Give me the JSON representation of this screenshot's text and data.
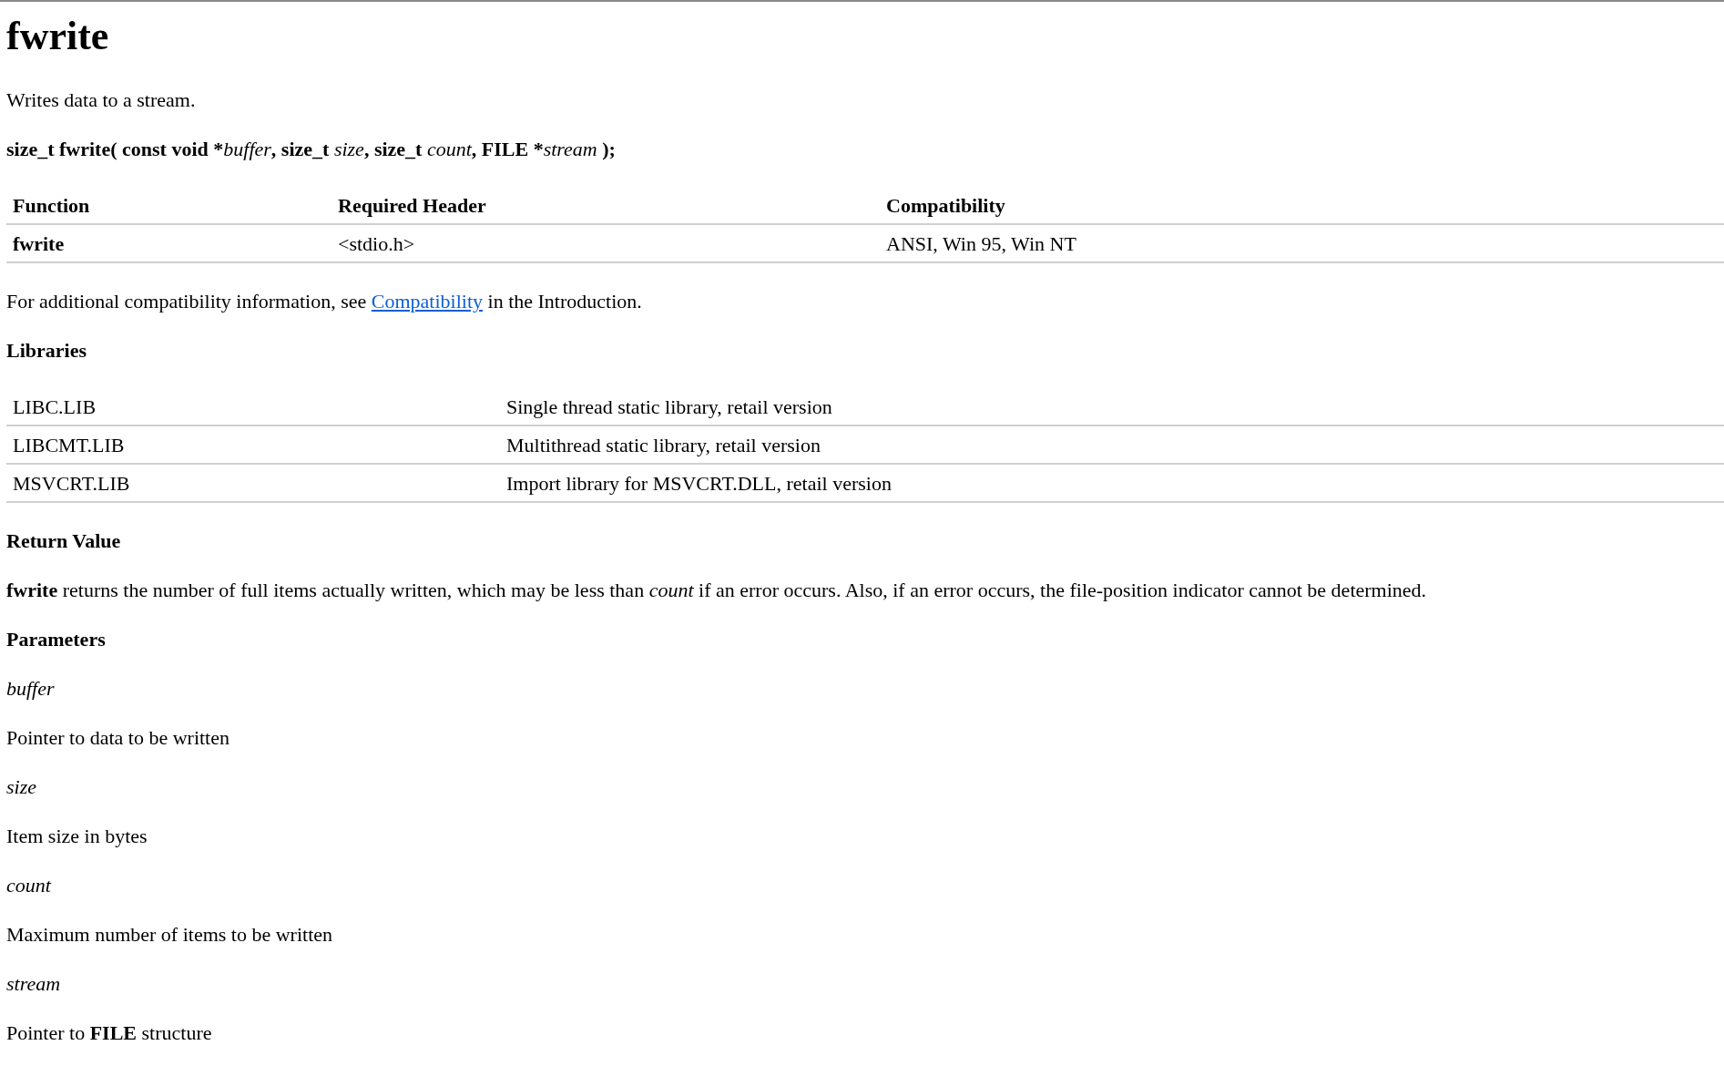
{
  "title": "fwrite",
  "summary": "Writes data to a stream.",
  "syntax": [
    {
      "kind": "bold",
      "text": "size_t fwrite( const void *"
    },
    {
      "kind": "italic",
      "text": "buffer"
    },
    {
      "kind": "bold",
      "text": ", size_t "
    },
    {
      "kind": "italic",
      "text": "size"
    },
    {
      "kind": "bold",
      "text": ", size_t "
    },
    {
      "kind": "italic",
      "text": "count"
    },
    {
      "kind": "bold",
      "text": ", FILE *"
    },
    {
      "kind": "italic",
      "text": "stream"
    },
    {
      "kind": "bold",
      "text": " );"
    }
  ],
  "requirements_table": {
    "columns": [
      "Function",
      "Required Header",
      "Compatibility"
    ],
    "rows": [
      [
        "fwrite",
        "<stdio.h>",
        "ANSI, Win 95, Win NT"
      ]
    ]
  },
  "compatibility_note": [
    {
      "kind": "plain",
      "text": "For additional compatibility information, see "
    },
    {
      "kind": "link",
      "text": "Compatibility"
    },
    {
      "kind": "plain",
      "text": " in the Introduction."
    }
  ],
  "libraries_heading": "Libraries",
  "libraries_table": {
    "rows": [
      [
        "LIBC.LIB",
        "Single thread static library, retail version"
      ],
      [
        "LIBCMT.LIB",
        "Multithread static library, retail version"
      ],
      [
        "MSVCRT.LIB",
        "Import library for MSVCRT.DLL, retail version"
      ]
    ]
  },
  "return_value_heading": "Return Value",
  "return_value": [
    {
      "kind": "bold",
      "text": "fwrite"
    },
    {
      "kind": "plain",
      "text": " returns the number of full items actually written, which may be less than "
    },
    {
      "kind": "italic",
      "text": "count"
    },
    {
      "kind": "plain",
      "text": " if an error occurs. Also, if an error occurs, the file-position indicator cannot be determined."
    }
  ],
  "parameters_heading": "Parameters",
  "parameters": [
    {
      "name": "buffer",
      "description": [
        {
          "kind": "plain",
          "text": "Pointer to data to be written"
        }
      ]
    },
    {
      "name": "size",
      "description": [
        {
          "kind": "plain",
          "text": "Item size in bytes"
        }
      ]
    },
    {
      "name": "count",
      "description": [
        {
          "kind": "plain",
          "text": "Maximum number of items to be written"
        }
      ]
    },
    {
      "name": "stream",
      "description": [
        {
          "kind": "plain",
          "text": "Pointer to "
        },
        {
          "kind": "bold",
          "text": "FILE"
        },
        {
          "kind": "plain",
          "text": " structure"
        }
      ]
    }
  ]
}
